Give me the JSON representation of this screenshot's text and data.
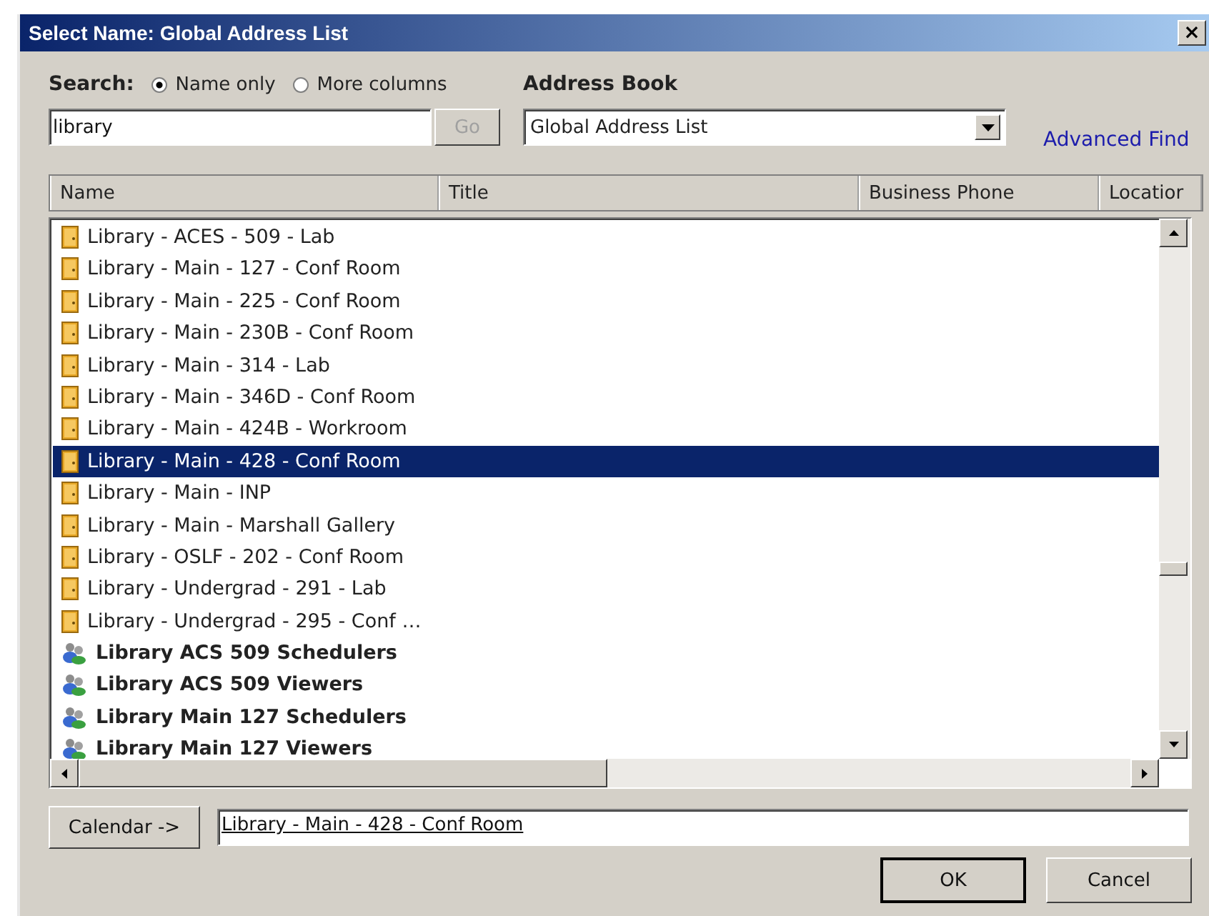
{
  "window": {
    "title": "Select Name: Global Address List",
    "close": "×"
  },
  "search": {
    "label": "Search:",
    "options": [
      {
        "label": "Name only",
        "selected": true
      },
      {
        "label": "More columns",
        "selected": false
      }
    ],
    "value": "library",
    "go_button": {
      "label": "Go",
      "disabled": true
    }
  },
  "address_book": {
    "label": "Address Book",
    "value": "Global Address List",
    "advanced_find": "Advanced Find"
  },
  "table": {
    "columns": [
      "Name",
      "Title",
      "Business Phone",
      "Locatior"
    ],
    "rows": [
      {
        "name": "Library - ACES - 509 - Lab",
        "kind": "room",
        "selected": false
      },
      {
        "name": "Library - Main - 127 - Conf Room",
        "kind": "room",
        "selected": false
      },
      {
        "name": "Library - Main - 225 - Conf Room",
        "kind": "room",
        "selected": false
      },
      {
        "name": "Library - Main - 230B - Conf Room",
        "kind": "room",
        "selected": false
      },
      {
        "name": "Library - Main - 314 - Lab",
        "kind": "room",
        "selected": false
      },
      {
        "name": "Library - Main - 346D - Conf Room",
        "kind": "room",
        "selected": false
      },
      {
        "name": "Library - Main - 424B - Workroom",
        "kind": "room",
        "selected": false
      },
      {
        "name": "Library - Main - 428 - Conf Room",
        "kind": "room",
        "selected": true
      },
      {
        "name": "Library - Main - INP",
        "kind": "room",
        "selected": false
      },
      {
        "name": "Library - Main - Marshall Gallery",
        "kind": "room",
        "selected": false
      },
      {
        "name": "Library - OSLF - 202 - Conf Room",
        "kind": "room",
        "selected": false
      },
      {
        "name": "Library - Undergrad - 291 - Lab",
        "kind": "room",
        "selected": false
      },
      {
        "name": "Library - Undergrad - 295 - Conf …",
        "kind": "room",
        "selected": false
      },
      {
        "name": "Library ACS 509 Schedulers",
        "kind": "group",
        "selected": false
      },
      {
        "name": "Library ACS 509 Viewers",
        "kind": "group",
        "selected": false
      },
      {
        "name": "Library Main 127 Schedulers",
        "kind": "group",
        "selected": false
      },
      {
        "name": "Library Main 127 Viewers",
        "kind": "group",
        "selected": false
      }
    ]
  },
  "calendar": {
    "button": "Calendar ->",
    "value": "Library - Main - 428 - Conf Room"
  },
  "buttons": [
    "OK",
    "Cancel"
  ]
}
